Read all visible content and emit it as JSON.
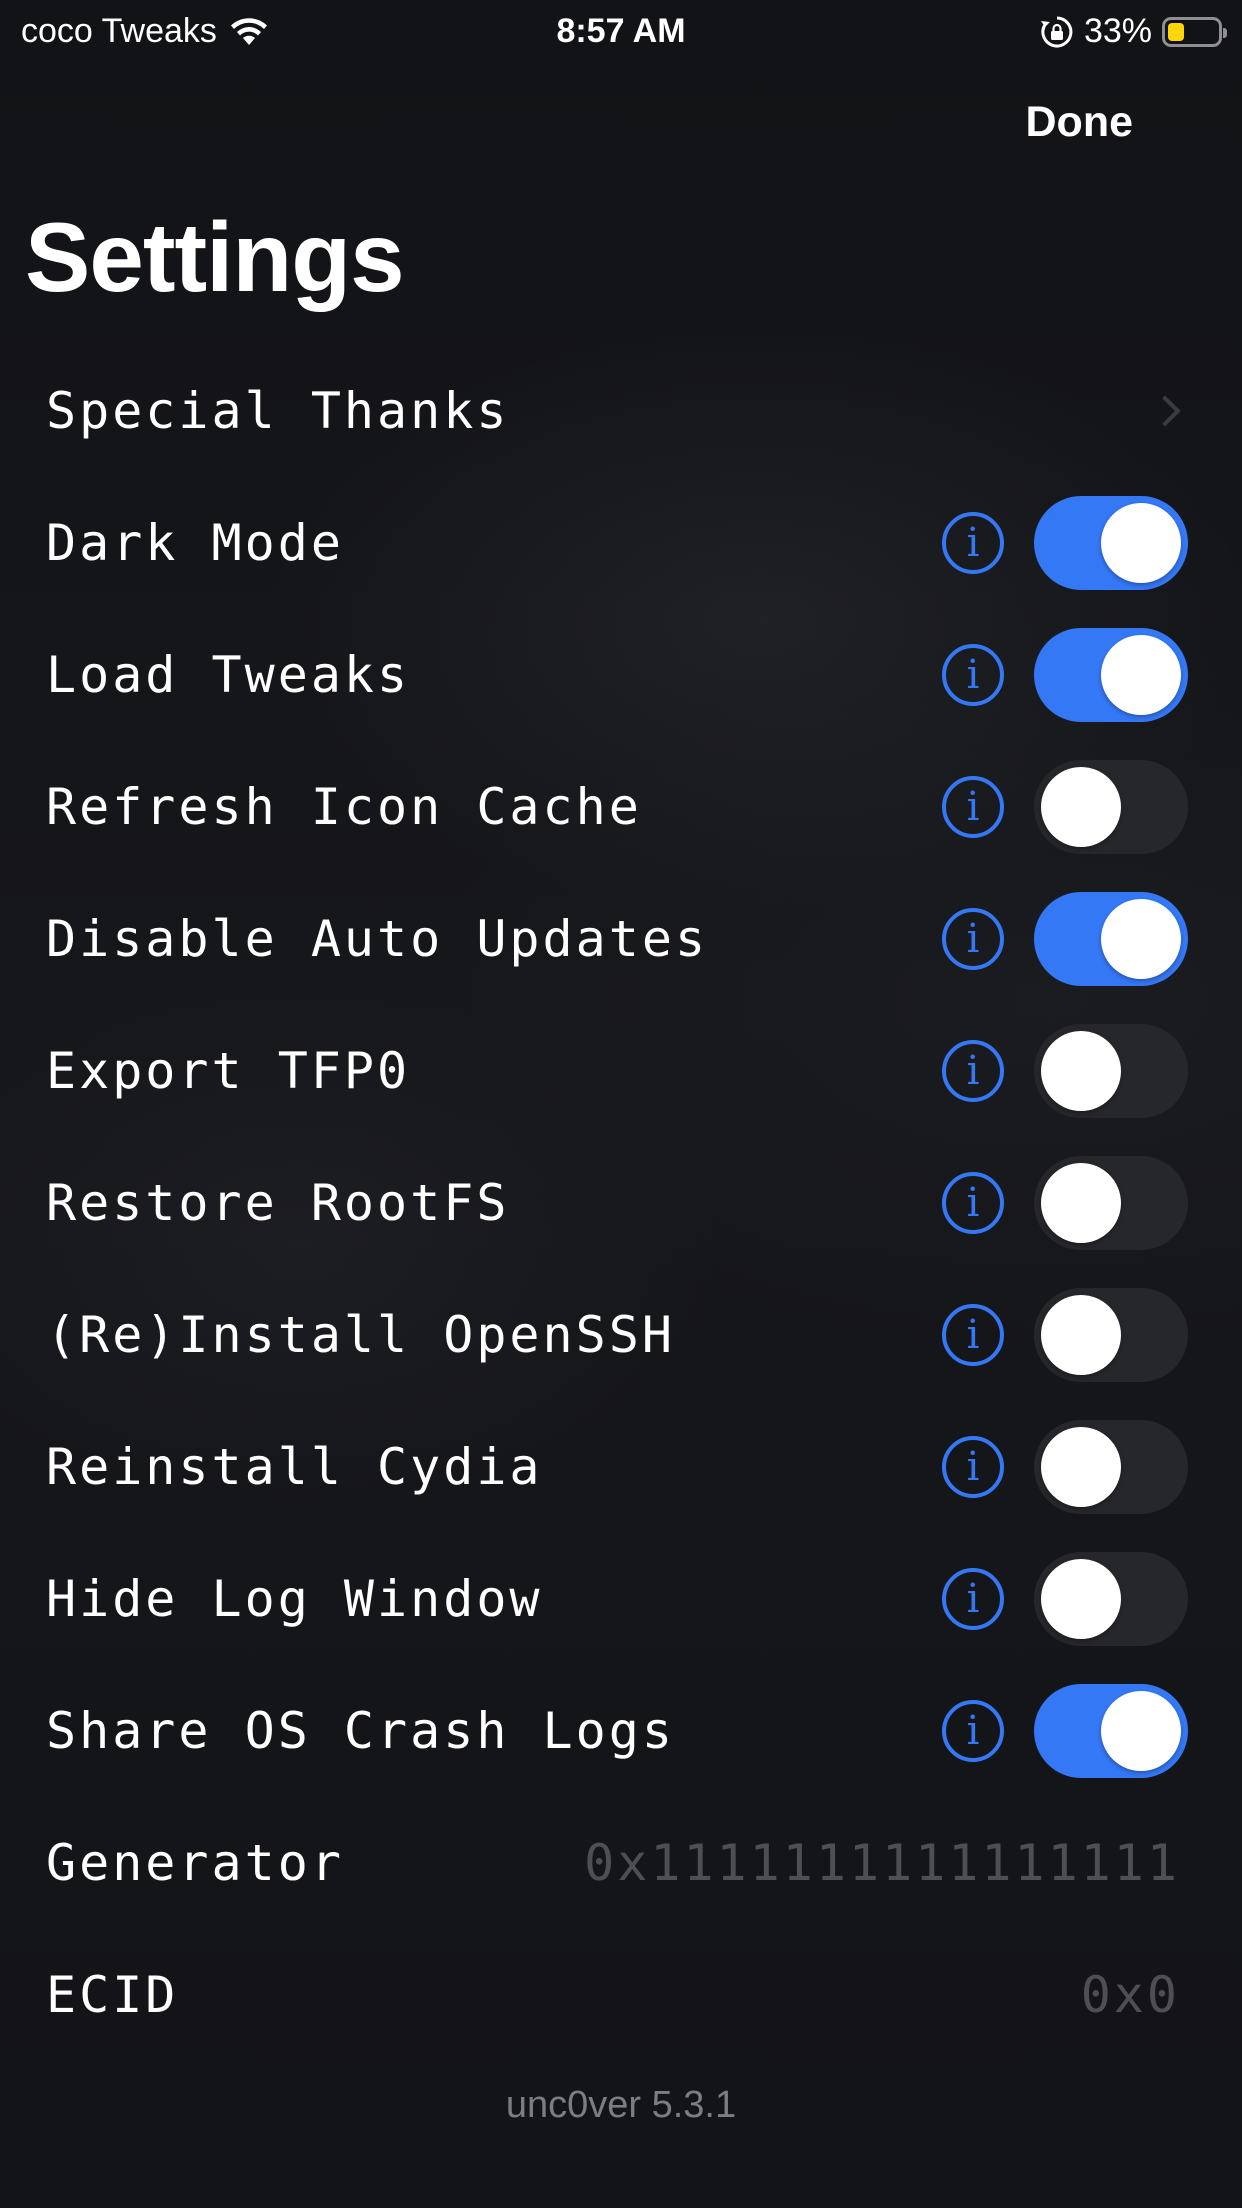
{
  "status_bar": {
    "carrier": "coco Tweaks",
    "time": "8:57 AM",
    "battery_percent": "33%",
    "battery_level": 0.33,
    "icons": [
      "wifi-icon",
      "orientation-lock-icon",
      "battery-icon"
    ]
  },
  "nav": {
    "done_label": "Done"
  },
  "page": {
    "title": "Settings"
  },
  "rows": {
    "special_thanks": {
      "label": "Special Thanks"
    },
    "dark_mode": {
      "label": "Dark Mode",
      "on": true
    },
    "load_tweaks": {
      "label": "Load Tweaks",
      "on": true
    },
    "refresh_icon_cache": {
      "label": "Refresh Icon Cache",
      "on": false
    },
    "disable_auto_updates": {
      "label": "Disable Auto Updates",
      "on": true
    },
    "export_tfp0": {
      "label": "Export TFP0",
      "on": false
    },
    "restore_rootfs": {
      "label": "Restore RootFS",
      "on": false
    },
    "reinstall_openssh": {
      "label": "(Re)Install OpenSSH",
      "on": false
    },
    "reinstall_cydia": {
      "label": "Reinstall Cydia",
      "on": false
    },
    "hide_log_window": {
      "label": "Hide Log Window",
      "on": false
    },
    "share_crash_logs": {
      "label": "Share OS Crash Logs",
      "on": true
    },
    "generator": {
      "label": "Generator",
      "value": "0x1111111111111111"
    },
    "ecid": {
      "label": "ECID",
      "value": "0x0"
    }
  },
  "info_glyph": "i",
  "footer": {
    "version": "unc0ver 5.3.1"
  },
  "colors": {
    "background": "#131418",
    "accent": "#3478f6",
    "toggle_off": "#26272b",
    "value_text": "#4e4f54",
    "battery": "#ffd60a"
  }
}
